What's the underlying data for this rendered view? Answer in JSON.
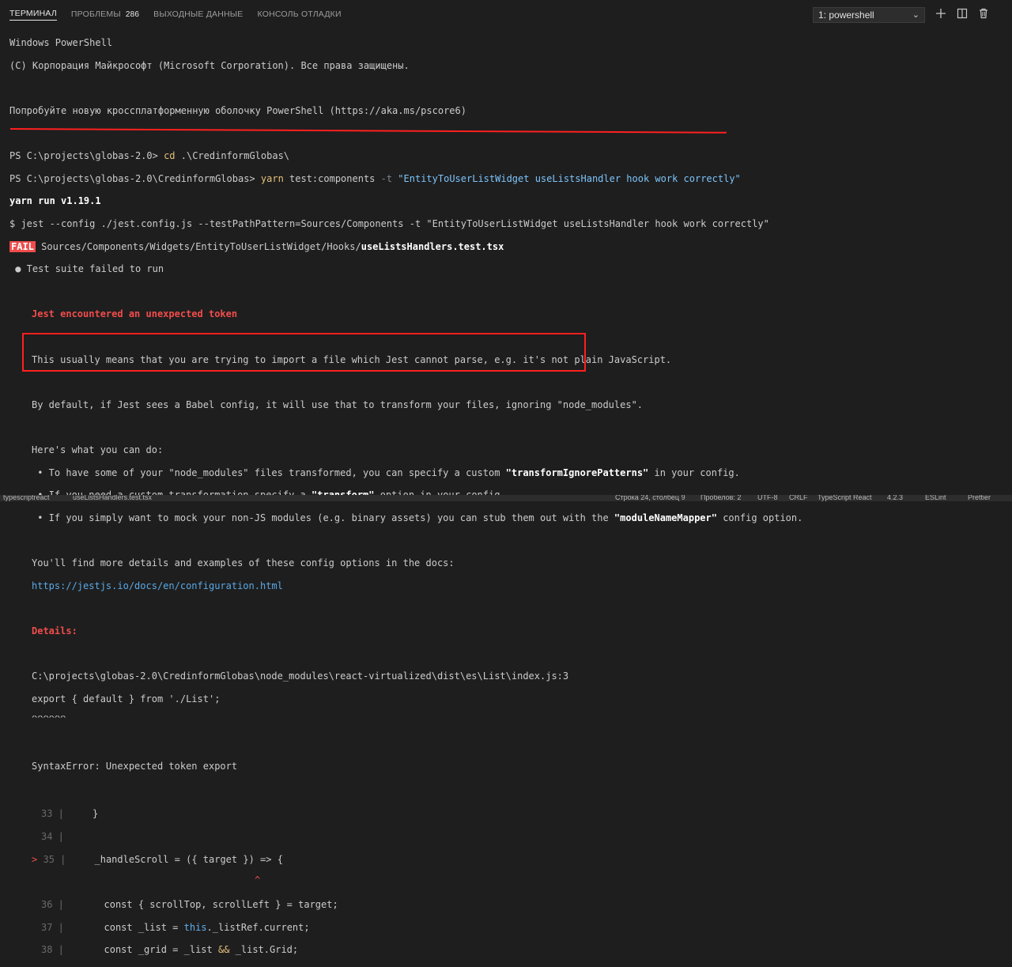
{
  "tabs": {
    "terminal": "ТЕРМИНАЛ",
    "problems": "ПРОБЛЕМЫ",
    "problems_count": "286",
    "output": "ВЫХОДНЫЕ ДАННЫЕ",
    "debug_console": "КОНСОЛЬ ОТЛАДКИ"
  },
  "terminal_select": {
    "value": "1: powershell"
  },
  "terminal": {
    "ps_header": "Windows PowerShell",
    "copyright": "(C) Корпорация Майкрософт (Microsoft Corporation). Все права защищены.",
    "try_new": "Попробуйте новую кроссплатформенную оболочку PowerShell (https://aka.ms/pscore6)",
    "prompt1": "PS C:\\projects\\globas-2.0> ",
    "cmd1_kw": "cd",
    "cmd1_arg": " .\\CredinformGlobas\\",
    "prompt2": "PS C:\\projects\\globas-2.0\\CredinformGlobas> ",
    "cmd2_kw": "yarn",
    "cmd2_arg": " test:components ",
    "cmd2_flag": "-t",
    "cmd2_str": " \"EntityToUserListWidget useListsHandler hook work correctly\"",
    "yarn_run": "yarn run v1.19.1",
    "jest_cmd": "$ jest --config ./jest.config.js --testPathPattern=Sources/Components -t \"EntityToUserListWidget useListsHandler hook work correctly\"",
    "fail_badge": "FAIL",
    "fail_path": " Sources/Components/Widgets/EntityToUserListWidget/Hooks/",
    "fail_file": "useListsHandlers.test.tsx",
    "suite_failed": " ● Test suite failed to run",
    "jest_unexpected": "Jest encountered an unexpected token",
    "usually": "This usually means that you are trying to import a file which Jest cannot parse, e.g. it's not plain JavaScript.",
    "by_default": "By default, if Jest sees a Babel config, it will use that to transform your files, ignoring \"node_modules\".",
    "what_do": "Here's what you can do:",
    "tip1_a": " • To have some of your \"node_modules\" files transformed, you can specify a custom ",
    "tip1_b": "\"transformIgnorePatterns\"",
    "tip1_c": " in your config.",
    "tip2_a": " • If you need a custom transformation specify a ",
    "tip2_b": "\"transform\"",
    "tip2_c": " option in your config.",
    "tip3_a": " • If you simply want to mock your non-JS modules (e.g. binary assets) you can stub them out with the ",
    "tip3_b": "\"moduleNameMapper\"",
    "tip3_c": " config option.",
    "find_more": "You'll find more details and examples of these config options in the docs:",
    "docs_link": "https://jestjs.io/docs/en/configuration.html",
    "details": "Details:",
    "err_path": "C:\\projects\\globas-2.0\\CredinformGlobas\\node_modules\\react-virtualized\\dist\\es\\List\\index.js:3",
    "err_code": "export { default } from './List';",
    "err_caret": "^^^^^^",
    "syntax_error": "SyntaxError: Unexpected token export",
    "code_33_num": "33",
    "code_33": "    }",
    "code_34_num": "34",
    "code_35_marker": ">",
    "code_35_num": "35",
    "code_35": "    _handleScroll = ({ target }) => {",
    "code_35_caret": "^",
    "code_36_num": "36",
    "code_36": "      const { scrollTop, scrollLeft } = target;",
    "code_37_num": "37",
    "code_37_a": "      const _list = ",
    "code_37_b": "this",
    "code_37_c": "._listRef.current;",
    "code_38_num": "38",
    "code_38_a": "      const _grid = _list ",
    "code_38_b": "&&",
    "code_38_c": " _list.Grid;"
  },
  "statusbar": {
    "left_lang": "typescriptreact",
    "left_file": "useListsHandlers.test.tsx",
    "position": "Строка 24, столбец 9",
    "spaces": "Пробелов: 2",
    "encoding": "UTF-8",
    "eol": "CRLF",
    "language": "TypeScript React",
    "version": "4.2.3",
    "eslint": "ESLint",
    "prettier": "Prettier"
  },
  "icons": [
    "plus-icon",
    "split-icon",
    "trash-icon",
    "chevron-down-icon"
  ]
}
